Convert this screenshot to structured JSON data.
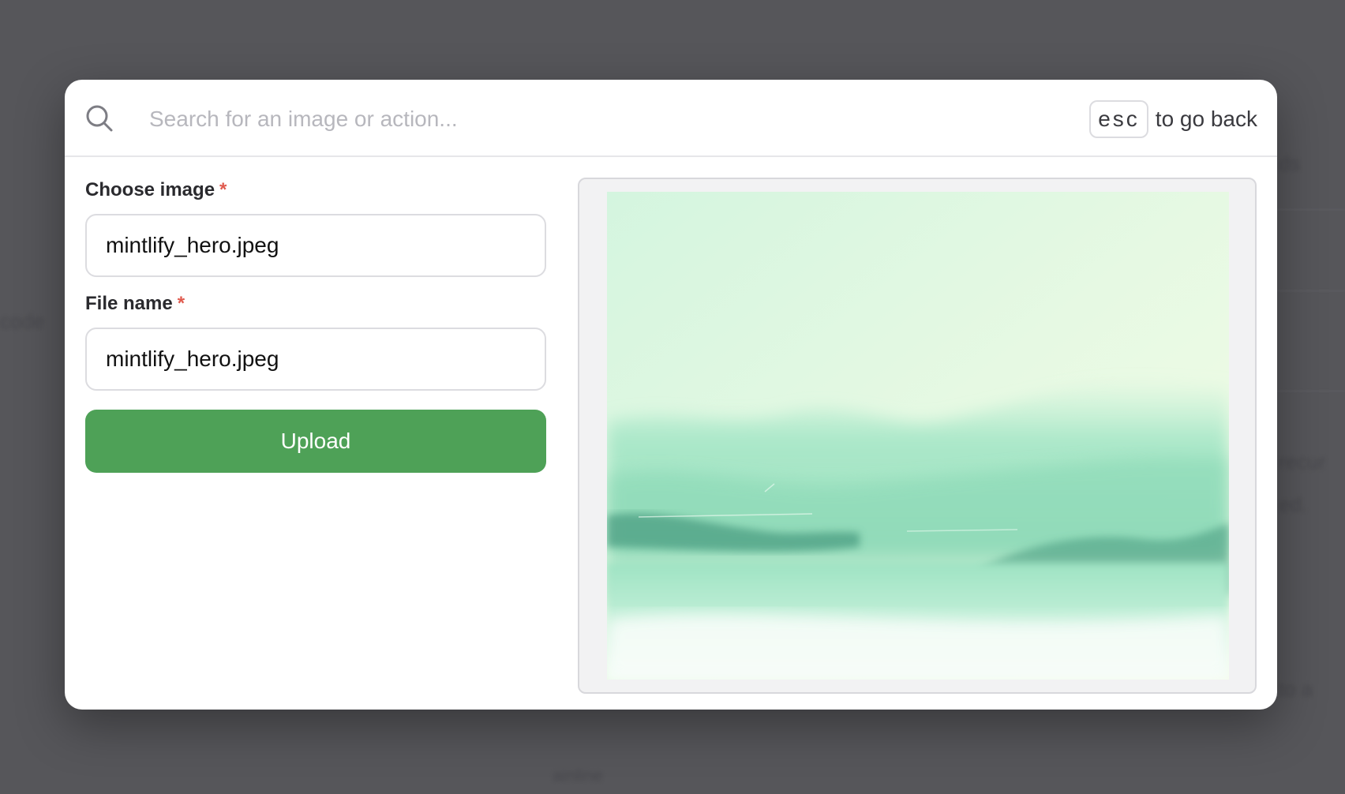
{
  "search": {
    "placeholder": "Search for an image or action...",
    "value": ""
  },
  "esc_hint": {
    "key": "esc",
    "text": "to go back"
  },
  "form": {
    "choose_image": {
      "label": "Choose image",
      "required_mark": "*",
      "value": "mintlify_hero.jpeg"
    },
    "file_name": {
      "label": "File name",
      "required_mark": "*",
      "value": "mintlify_hero.jpeg"
    },
    "upload_label": "Upload"
  },
  "preview": {
    "description": "watercolor mint-green landscape"
  },
  "colors": {
    "accent": "#4ea157",
    "required": "#e05a4e",
    "backdrop": "#56565a"
  }
}
